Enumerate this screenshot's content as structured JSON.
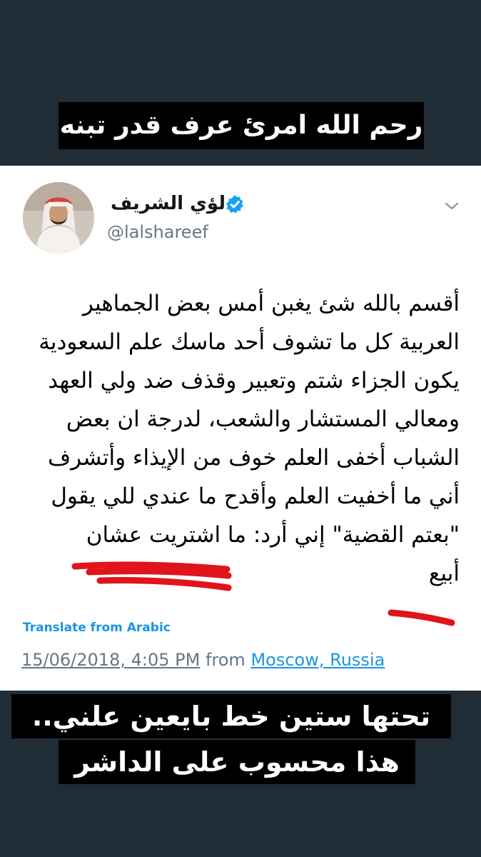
{
  "captions": {
    "top": "رحم الله امرئ عرف قدر تبنه",
    "bottom_line1": "تحتها ستين خط بايعين علني..",
    "bottom_line2": "هذا محسوب على الداشر"
  },
  "tweet": {
    "display_name": "لؤي الشريف",
    "handle": "@lalshareef",
    "verified": true,
    "body_lines": [
      "أقسم بالله شئ يغبن أمس بعض الجماهير",
      "العربية كل ما تشوف أحد ماسك علم السعودية",
      "يكون الجزاء شتم وتعبير وقذف ضد ولي العهد",
      "ومعالي المستشار والشعب، لدرجة ان بعض",
      "الشباب أخفى العلم خوف من الإيذاء وأتشرف",
      "أني ما أخفيت العلم وأقدح ما عندي للي يقول",
      "\"بعتم القضية\" إني أرد: ما اشتريت عشان",
      "أبيع"
    ],
    "translate_label": "Translate from Arabic",
    "timestamp": "15/06/2018, 4:05 PM",
    "from_label": "from",
    "location": "Moscow, Russia"
  },
  "colors": {
    "background": "#202c36",
    "card": "#ffffff",
    "link": "#1b95e0",
    "muted": "#657786",
    "marker": "#e0151b"
  },
  "icons": {
    "verified": "verified-badge-icon",
    "chevron": "chevron-down-icon"
  }
}
